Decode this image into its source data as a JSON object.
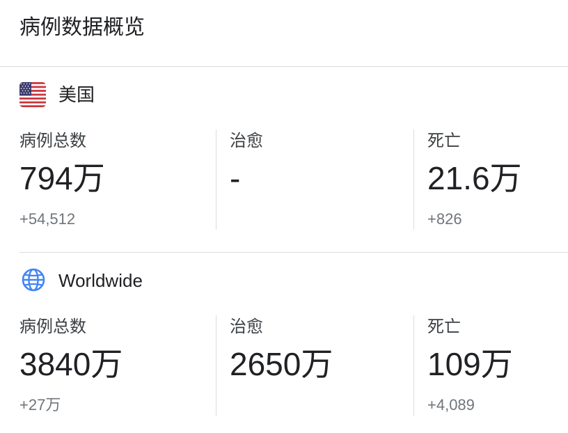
{
  "header": {
    "title": "病例数据概览"
  },
  "regions": [
    {
      "name": "美国",
      "icon": "us-flag-icon",
      "stats": {
        "cases": {
          "label": "病例总数",
          "value": "794万",
          "delta": "+54,512"
        },
        "recovered": {
          "label": "治愈",
          "value": "-",
          "delta": ""
        },
        "deaths": {
          "label": "死亡",
          "value": "21.6万",
          "delta": "+826"
        }
      }
    },
    {
      "name": "Worldwide",
      "icon": "globe-icon",
      "stats": {
        "cases": {
          "label": "病例总数",
          "value": "3840万",
          "delta": "+27万"
        },
        "recovered": {
          "label": "治愈",
          "value": "2650万",
          "delta": ""
        },
        "deaths": {
          "label": "死亡",
          "value": "109万",
          "delta": "+4,089"
        }
      }
    }
  ],
  "colors": {
    "text_primary": "#202124",
    "text_secondary": "#70757a",
    "divider": "#dadce0",
    "globe_blue": "#4285f4",
    "flag_red": "#c8363c",
    "flag_blue": "#3c3b6e"
  }
}
